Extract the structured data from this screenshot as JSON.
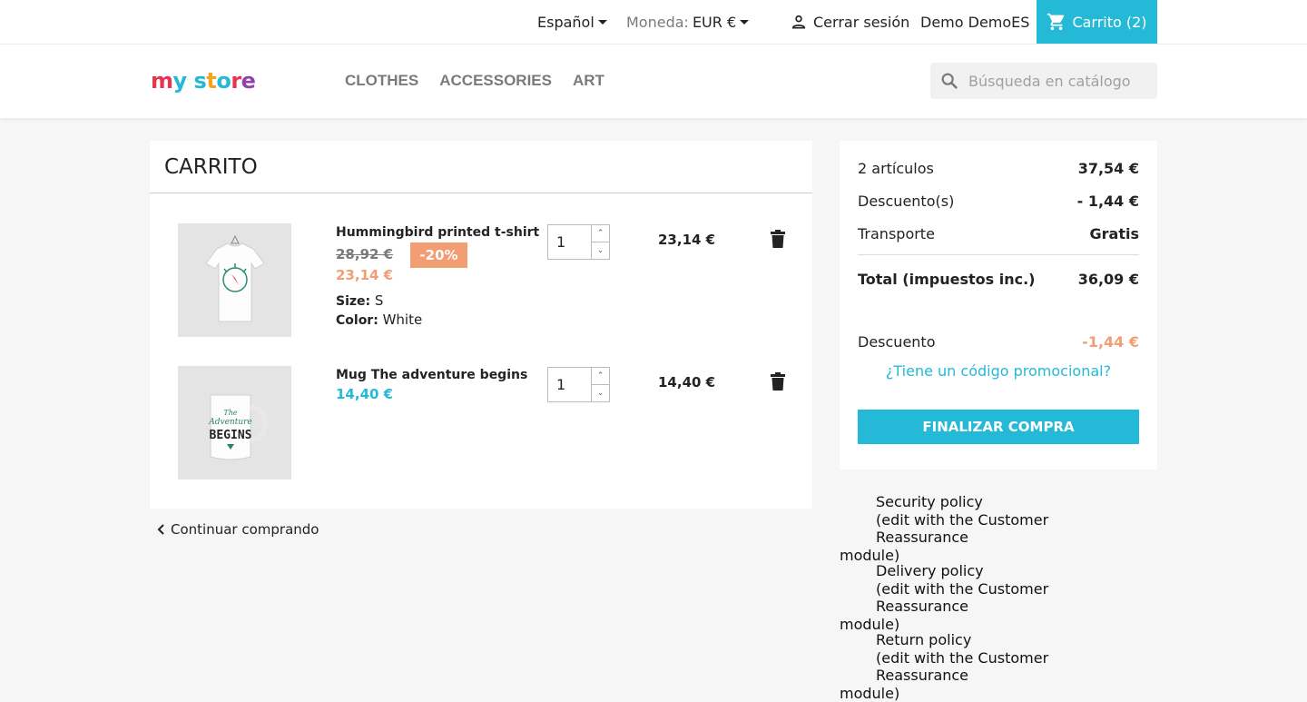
{
  "topbar": {
    "language": "Español",
    "currency_label": "Moneda:",
    "currency_value": "EUR €",
    "logout": "Cerrar sesión",
    "user": "Demo DemoES",
    "cart": "Carrito (2)"
  },
  "header": {
    "logo_text": "my store",
    "nav": [
      "CLOTHES",
      "ACCESSORIES",
      "ART"
    ],
    "search_placeholder": "Búsqueda en catálogo"
  },
  "cart": {
    "title": "CARRITO",
    "items": [
      {
        "name": "Hummingbird printed t-shirt",
        "old_price": "28,92 €",
        "discount_badge": "-20%",
        "price": "23,14 €",
        "size_label": "Size:",
        "size_value": "S",
        "color_label": "Color:",
        "color_value": "White",
        "qty": "1",
        "total": "23,14 €"
      },
      {
        "name": "Mug The adventure begins",
        "price": "14,40 €",
        "qty": "1",
        "total": "14,40 €"
      }
    ],
    "continue": "Continuar comprando"
  },
  "summary": {
    "items_label": "2 artículos",
    "items_value": "37,54 €",
    "discounts_label": "Descuento(s)",
    "discounts_value": "- 1,44 €",
    "shipping_label": "Transporte",
    "shipping_value": "Gratis",
    "total_label": "Total (impuestos inc.)",
    "total_value": "36,09 €",
    "voucher_label": "Descuento",
    "voucher_value": "-1,44 €",
    "promo_link": "¿Tiene un código promocional?",
    "checkout": "FINALIZAR COMPRA"
  },
  "reassurance": [
    {
      "title": "Security policy",
      "desc": "(edit with the Customer Reassurance",
      "desc2": "module)"
    },
    {
      "title": "Delivery policy",
      "desc": "(edit with the Customer Reassurance",
      "desc2": "module)"
    },
    {
      "title": "Return policy",
      "desc": "(edit with the Customer Reassurance",
      "desc2": "module)"
    }
  ],
  "colors": {
    "accent": "#24b9d7",
    "discount": "#f39d72"
  },
  "icons": [
    "caret-down-icon",
    "user-icon",
    "cart-icon",
    "search-icon",
    "trash-icon",
    "chevron-left-icon"
  ]
}
